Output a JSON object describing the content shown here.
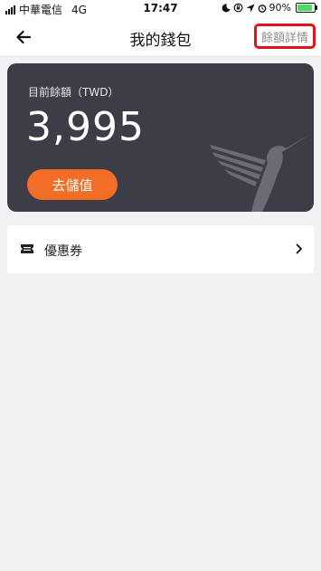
{
  "status_bar": {
    "carrier": "中華電信",
    "network": "4G",
    "time": "17:47",
    "battery": "90%",
    "battery_level": 0.9
  },
  "nav": {
    "title": "我的錢包",
    "right_action": "餘額詳情"
  },
  "wallet": {
    "balance_label": "目前餘額（TWD）",
    "balance": "3,995",
    "topup_label": "去儲值"
  },
  "menu": {
    "coupon_label": "優惠券"
  },
  "colors": {
    "accent": "#f26d25",
    "card": "#3d3d47",
    "highlight": "#e3131b"
  }
}
